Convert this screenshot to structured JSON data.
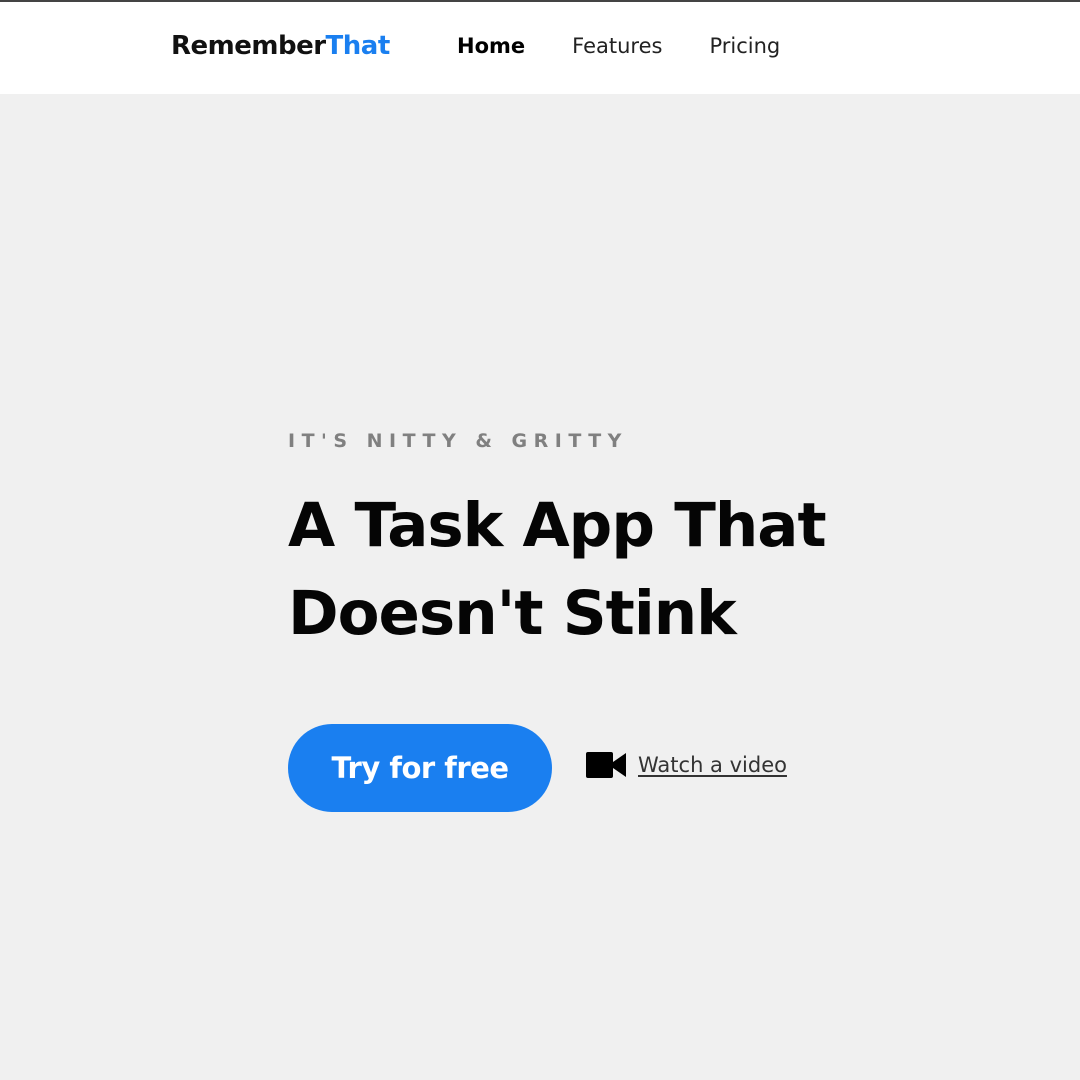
{
  "nav": {
    "logo_part1": "Remember",
    "logo_part2": "That",
    "links": [
      {
        "label": "Home",
        "active": true
      },
      {
        "label": "Features",
        "active": false
      },
      {
        "label": "Pricing",
        "active": false
      }
    ]
  },
  "hero": {
    "eyebrow": "IT'S NITTY & GRITTY",
    "headline_line1": "A Task App That",
    "headline_line2": "Doesn't Stink",
    "cta_label": "Try for free",
    "video_link_label": "Watch a video",
    "video_icon": "video-camera-icon"
  },
  "colors": {
    "accent": "#1a7ff0",
    "background": "#f0f0f0",
    "navbar": "#ffffff",
    "eyebrow": "#808080"
  }
}
